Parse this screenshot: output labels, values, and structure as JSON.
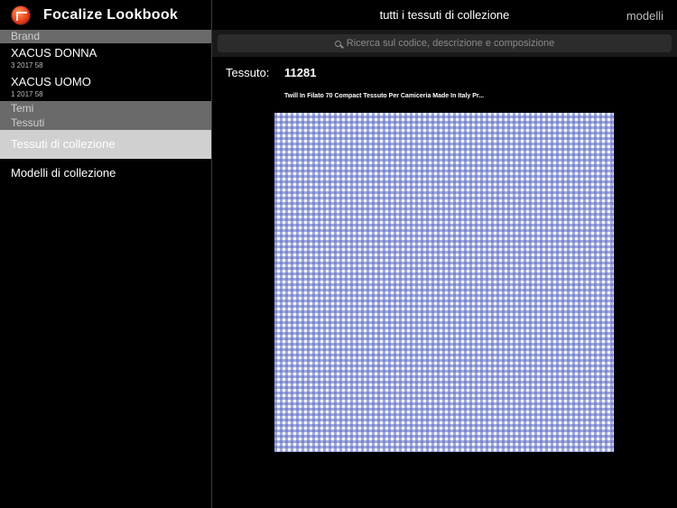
{
  "sidebar": {
    "app_title": "Focalize Lookbook",
    "section_brand": "Brand",
    "brands": [
      {
        "name": "XACUS DONNA",
        "sub": "3 2017 58"
      },
      {
        "name": "XACUS UOMO",
        "sub": "1 2017 58"
      }
    ],
    "section_temi": "Temi",
    "section_tessuti": "Tessuti",
    "nav": [
      {
        "label": "Tessuti di collezione",
        "active": true
      },
      {
        "label": "Modelli di collezione",
        "active": false
      }
    ]
  },
  "header": {
    "title": "tutti i tessuti di collezione",
    "right_link": "modelli"
  },
  "search": {
    "placeholder": "Ricerca sul codice, descrizione e composizione"
  },
  "detail": {
    "label": "Tessuto:",
    "code": "11281",
    "description": "Twill In Filato 70 Compact Tessuto Per Camiceria Made In Italy Pr..."
  },
  "colors": {
    "fabric_check": "#5c6cc4",
    "fabric_base": "#f2f3fb",
    "logo": "#e8401c"
  }
}
